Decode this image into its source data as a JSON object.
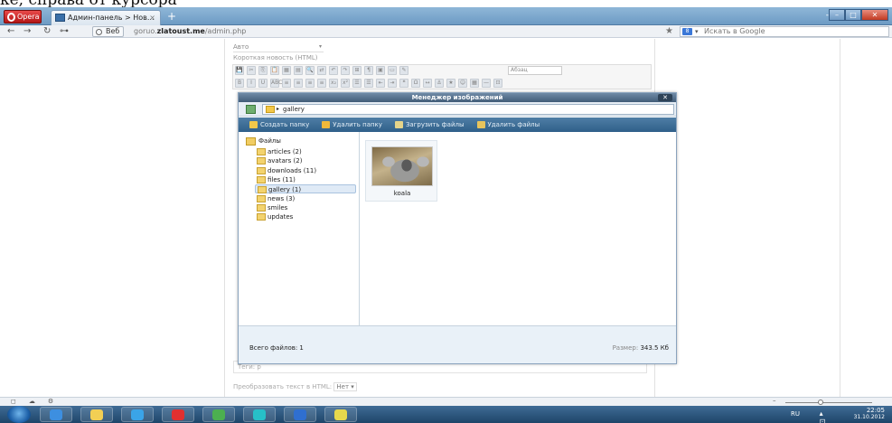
{
  "caption": "ке, справа от курсора",
  "browser": {
    "menu_label": "Opera",
    "tab_title": "Админ-панель > Нов...",
    "tab_close": "×",
    "new_tab": "+",
    "back": "←",
    "forward": "→",
    "reload": "↻",
    "key_icon": "⊶",
    "web_label": "Веб",
    "url_host": "goruo.zlatoust.me",
    "url_path": "/admin.php",
    "url_prefix": "goruo.",
    "url_domain": "zlatoust.me",
    "star": "★",
    "search_placeholder": "Искать в Google",
    "search_engine_icon": "8",
    "search_arrow": "▾",
    "min": "–",
    "max": "□",
    "close": "✕",
    "dash": "-"
  },
  "form": {
    "select_value": "Авто",
    "select_arrow": "▾",
    "short_news_label": "Короткая новость (HTML)",
    "format_select": "Абзац",
    "tags_label": "Теги: p",
    "convert_label": "Преобразовать текст в HTML:",
    "convert_value": "Нет ▾"
  },
  "toolbar_row1": [
    "💾",
    "✂",
    "⎘",
    "📋",
    "▦",
    "▤",
    "🔍",
    "⇄",
    "↶",
    "↷",
    "⊞",
    "¶",
    "▣",
    "▭",
    "✎"
  ],
  "toolbar_row2": [
    "B",
    "I",
    "U",
    "ABC",
    "≡",
    "≡",
    "≡",
    "≡",
    "x₂",
    "x²",
    "☰",
    "☰",
    "⇤",
    "⇥",
    "❝",
    "Ω",
    "↔",
    "⚓",
    "★",
    "☺",
    "▦",
    "—",
    "⊡"
  ],
  "dialog": {
    "title": "Менеджер изображений",
    "close": "✕",
    "path_sep": "▸",
    "path_current": "gallery",
    "actions": [
      {
        "label": "Создать папку",
        "color": "#f3c84a"
      },
      {
        "label": "Удалить папку",
        "color": "#f0b83a"
      },
      {
        "label": "Загрузить файлы",
        "color": "#e5d48a"
      },
      {
        "label": "Удалить файлы",
        "color": "#e8c45c"
      }
    ],
    "tree_root": "Файлы",
    "tree_items": [
      "articles (2)",
      "avatars (2)",
      "downloads (11)",
      "files  (11)",
      "gallery (1)",
      "news (3)",
      "smiles",
      "updates"
    ],
    "selected_folder": "gallery (1)",
    "thumbnail_label": "koala",
    "status_total": "Всего файлов: 1",
    "status_size_label": "Размер:",
    "status_size_value": "343.5 Кб"
  },
  "statusbar": {
    "icons": [
      "◻",
      "☁",
      "⚙"
    ],
    "zoom_minus": "–"
  },
  "taskbar": {
    "lang": "RU",
    "tray_symbols": "▴ ⊡ ◀))",
    "time": "22:05",
    "date": "31.10.2012",
    "apps": [
      {
        "name": "ie",
        "color": "#3d8fe0"
      },
      {
        "name": "explorer",
        "color": "#f2cf54"
      },
      {
        "name": "media",
        "color": "#3aa4e8"
      },
      {
        "name": "opera",
        "color": "#e03030"
      },
      {
        "name": "chrome",
        "color": "#4caf50"
      },
      {
        "name": "skype-like",
        "color": "#27c0c8"
      },
      {
        "name": "word",
        "color": "#2f6fd0"
      },
      {
        "name": "paint",
        "color": "#e6d84c"
      }
    ]
  }
}
